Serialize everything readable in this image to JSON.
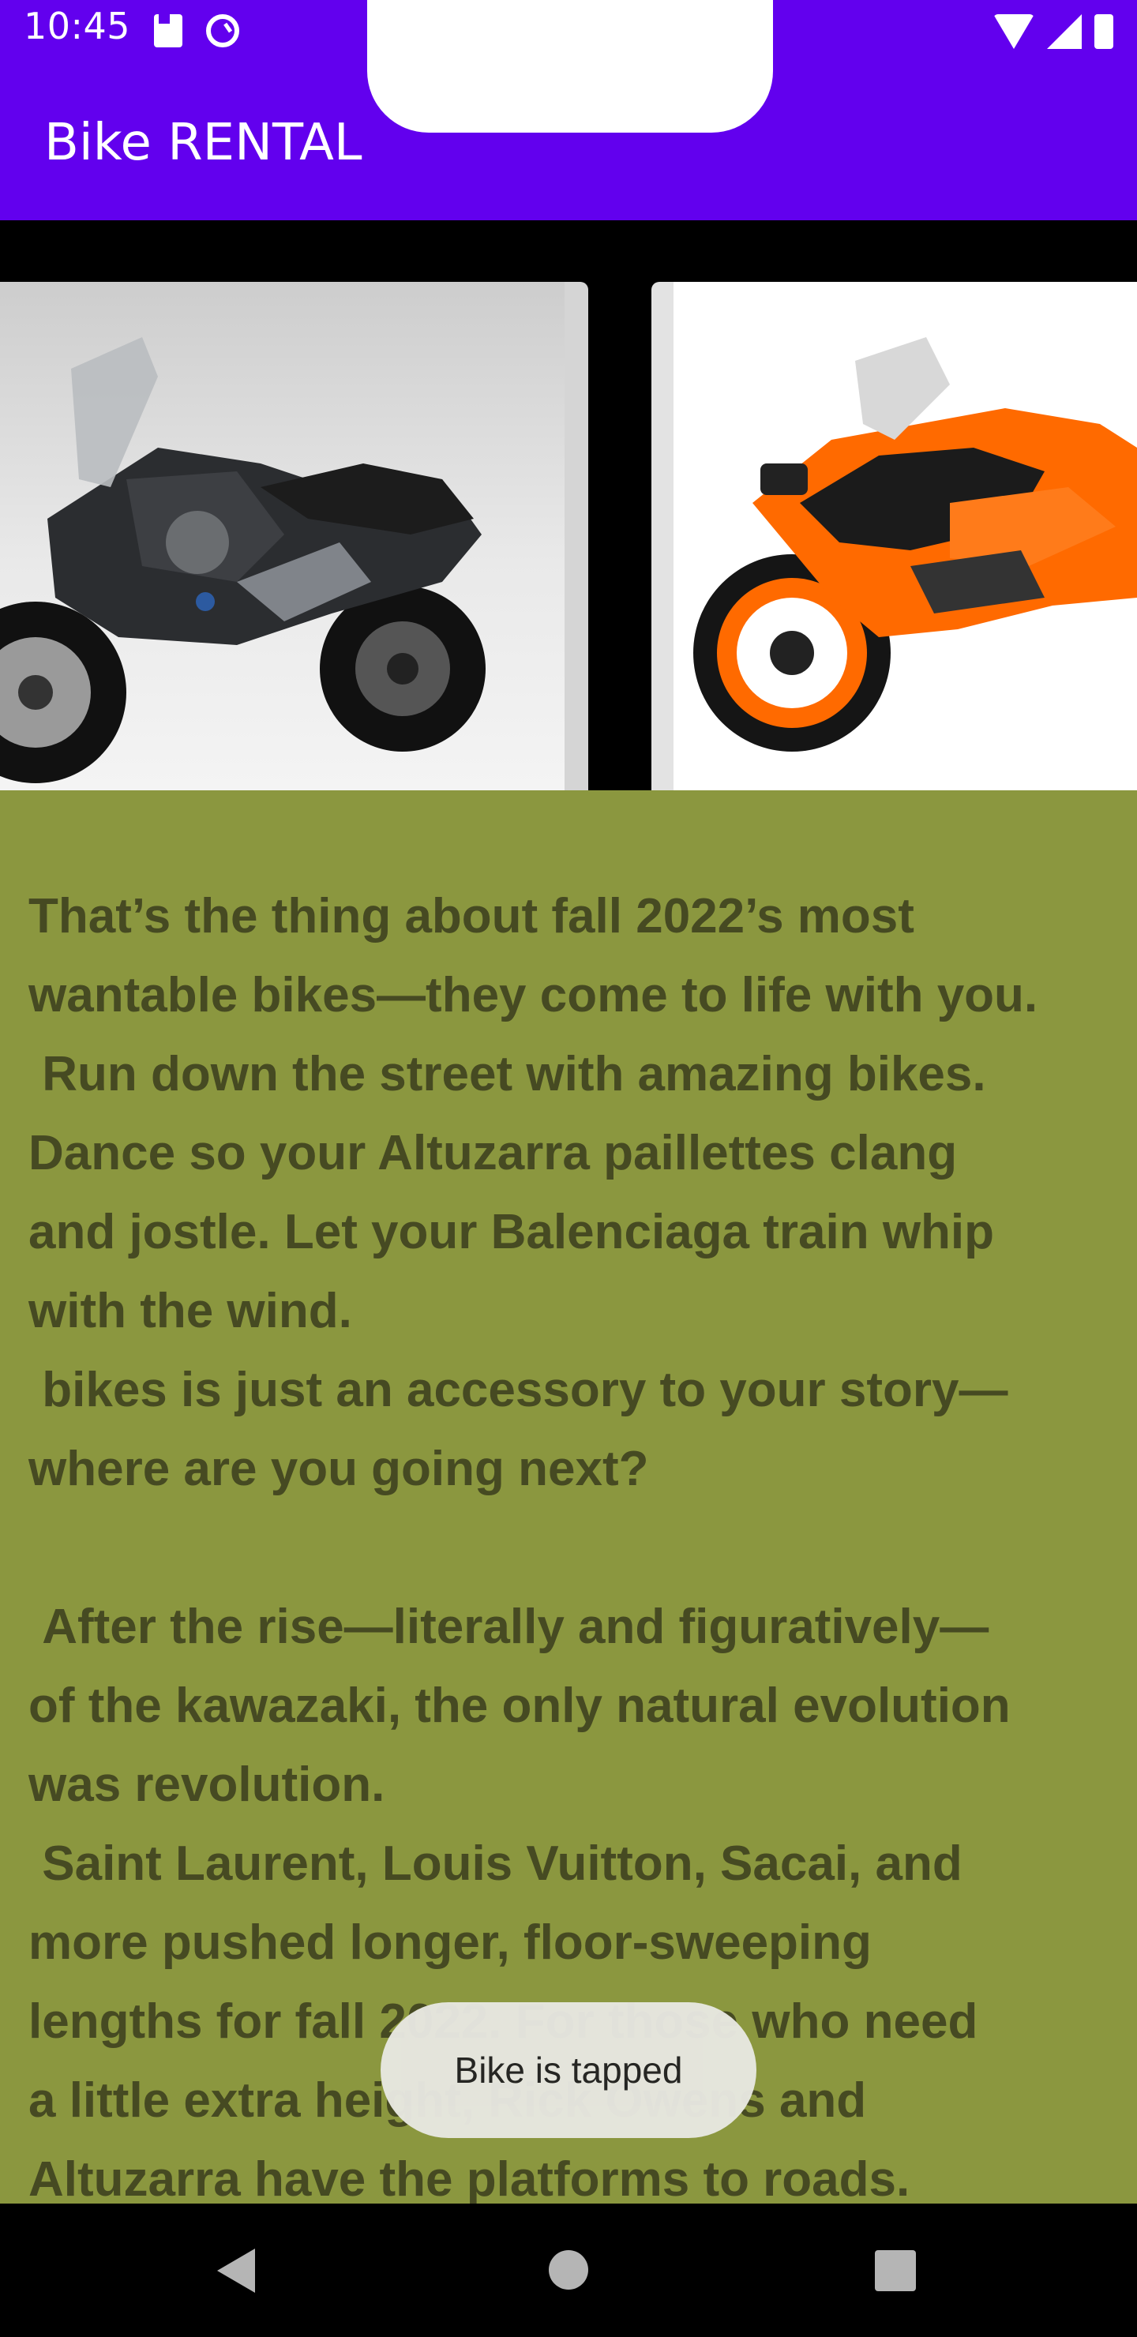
{
  "status_bar": {
    "time": "10:45",
    "left_icons": [
      "sd-card-icon",
      "accessibility-icon"
    ],
    "right_icons": [
      "wifi-icon",
      "cell-signal-icon",
      "battery-icon"
    ]
  },
  "app_bar": {
    "title": "Bike RENTAL",
    "color": "#6200ee"
  },
  "carousel": {
    "items": [
      {
        "name": "bike-image-bmw-adventure",
        "description_icon": "motorcycle-icon"
      },
      {
        "name": "bike-image-ktm-rc",
        "description_icon": "motorcycle-icon"
      }
    ]
  },
  "article": {
    "background": "#8b973f",
    "text": "That’s the thing about fall 2022’s most\nwantable bikes—they come to life with you.\n Run down the street with amazing bikes.\nDance so your Altuzarra paillettes clang\nand jostle. Let your Balenciaga train whip\nwith the wind.\n bikes is just an accessory to your story—\nwhere are you going next?\n\n After the rise—literally and figuratively—\nof the kawazaki, the only natural evolution\nwas revolution.\n Saint Laurent, Louis Vuitton, Sacai, and\nmore pushed longer, floor-sweeping\nlengths for fall 2022. For those who need\na little extra height, Rick Owens and\nAltuzarra have the platforms to roads."
  },
  "toast": {
    "message": "Bike is tapped"
  },
  "nav_bar": {
    "buttons": [
      "back-icon",
      "home-icon",
      "recents-icon"
    ]
  }
}
